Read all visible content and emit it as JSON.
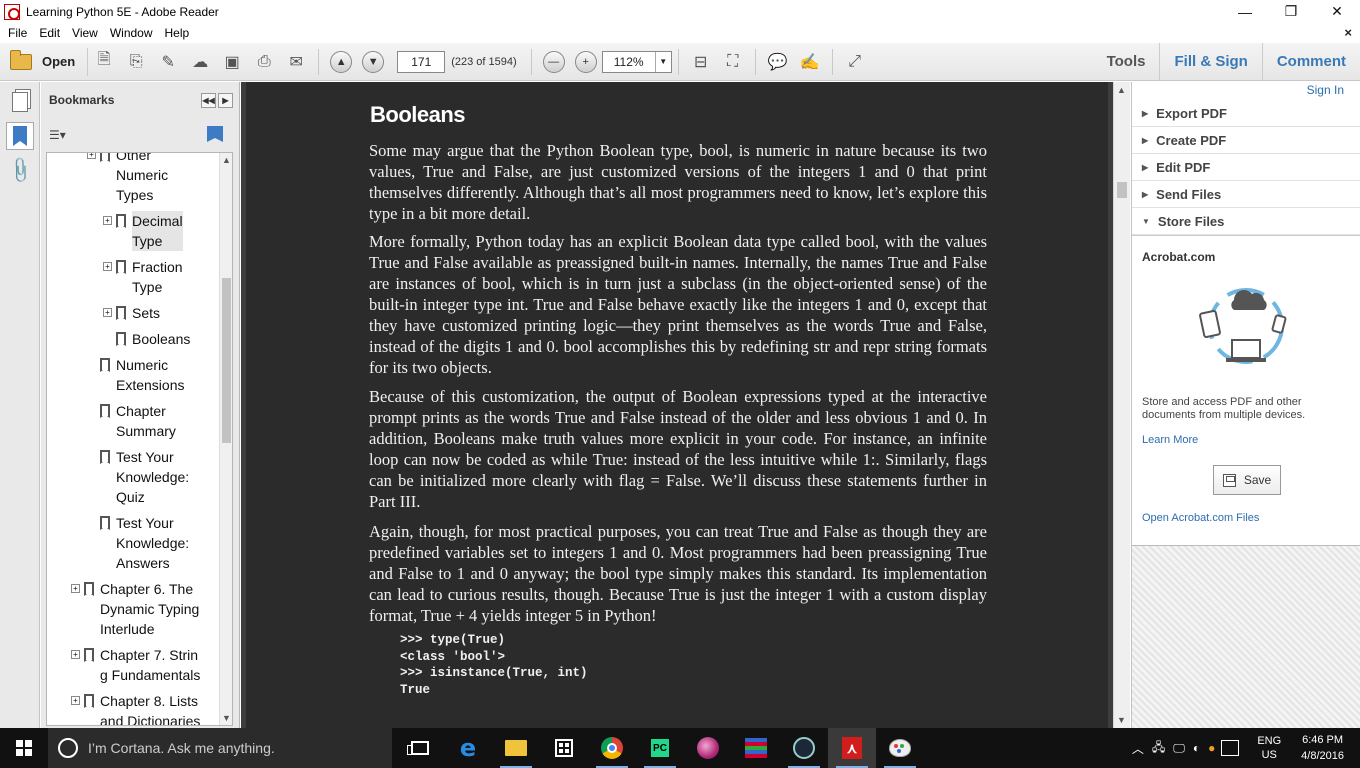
{
  "window": {
    "title": "Learning Python 5E - Adobe Reader",
    "controls": {
      "minimize": "—",
      "maximize": "❐",
      "close": "✕"
    }
  },
  "menu": {
    "items": [
      "File",
      "Edit",
      "View",
      "Window",
      "Help"
    ],
    "close_doc": "×"
  },
  "toolbar": {
    "open_label": "Open",
    "page_number": "171",
    "page_count": "(223 of 1594)",
    "zoom": "112%",
    "tools_label": "Tools",
    "fill_sign_label": "Fill & Sign",
    "comment_label": "Comment",
    "icons": [
      "create-pdf-icon",
      "convert-icon",
      "edit-icon",
      "upload-icon",
      "save-icon",
      "print-icon",
      "email-icon",
      "prev-page-icon",
      "next-page-icon",
      "zoom-out-icon",
      "zoom-in-icon",
      "fit-page-icon",
      "full-screen-icon",
      "comment-icon",
      "highlight-icon",
      "read-mode-icon"
    ]
  },
  "bookmarks": {
    "title": "Bookmarks",
    "options_icon": "options-menu-icon",
    "items": [
      {
        "label": "Other Numeric Types",
        "lines": [
          "Other",
          "Numeric",
          "Types"
        ],
        "level": 2,
        "expander": true,
        "selected": false
      },
      {
        "label": "Decimal Type",
        "lines": [
          "Decimal",
          "Type"
        ],
        "level": 3,
        "expander": true,
        "selected": true
      },
      {
        "label": "Fraction Type",
        "lines": [
          "Fraction",
          "Type"
        ],
        "level": 3,
        "expander": true,
        "selected": false
      },
      {
        "label": "Sets",
        "lines": [
          "Sets"
        ],
        "level": 3,
        "expander": true,
        "selected": false
      },
      {
        "label": "Booleans",
        "lines": [
          "Booleans"
        ],
        "level": 3,
        "expander": false,
        "selected": false
      },
      {
        "label": "Numeric Extensions",
        "lines": [
          "Numeric",
          "Extensions"
        ],
        "level": 2,
        "expander": false,
        "selected": false
      },
      {
        "label": "Chapter Summary",
        "lines": [
          "Chapter",
          "Summary"
        ],
        "level": 2,
        "expander": false,
        "selected": false
      },
      {
        "label": "Test Your Knowledge: Quiz",
        "lines": [
          "Test Your",
          "Knowledge:",
          "Quiz"
        ],
        "level": 2,
        "expander": false,
        "selected": false
      },
      {
        "label": "Test Your Knowledge: Answers",
        "lines": [
          "Test Your",
          "Knowledge:",
          "Answers"
        ],
        "level": 2,
        "expander": false,
        "selected": false
      },
      {
        "label": "Chapter 6. The Dynamic Typing Interlude",
        "lines": [
          "Chapter 6. The",
          "Dynamic Typing",
          "Interlude"
        ],
        "level": 1,
        "expander": true,
        "selected": false
      },
      {
        "label": "Chapter 7. String Fundamentals",
        "lines": [
          "Chapter 7. Strin",
          "g Fundamentals"
        ],
        "level": 1,
        "expander": true,
        "selected": false
      },
      {
        "label": "Chapter 8. Lists and Dictionaries",
        "lines": [
          "Chapter 8. Lists",
          "and Dictionaries"
        ],
        "level": 1,
        "expander": true,
        "selected": false
      }
    ]
  },
  "document": {
    "heading": "Booleans",
    "paragraphs": [
      "Some may argue that the Python Boolean type, bool, is numeric in nature because its two values, True and False, are just customized versions of the integers 1 and 0 that print themselves differently. Although that’s all most programmers need to know, let’s explore this type in a bit more detail.",
      "More formally, Python today has an explicit Boolean data type called bool, with the values True and False available as preassigned built-in names. Internally, the names True and False are instances of bool, which is in turn just a subclass (in the object-oriented sense) of the built-in integer type int. True and False behave exactly like the integers 1 and 0, except that they have customized printing logic—they print themselves as the words True and False, instead of the digits 1 and 0. bool accomplishes this by redefining str and repr string formats for its two objects.",
      "Because of this customization, the output of Boolean expressions typed at the interactive prompt prints as the words True and False instead of the older and less obvious 1 and 0. In addition, Booleans make truth values more explicit in your code. For instance, an infinite loop can now be coded as while True: instead of the less intuitive while 1:. Similarly, flags can be initialized more clearly with flag = False. We’ll discuss these statements further in Part III.",
      "Again, though, for most practical purposes, you can treat True and False as though they are predefined variables set to integers 1 and 0. Most programmers had been preassigning True and False to 1 and 0 anyway; the bool type simply makes this standard. Its implementation can lead to curious results, though. Because True is just the integer 1 with a custom display format, True + 4 yields integer 5 in Python!"
    ],
    "code": ">>> type(True)\n<class 'bool'>\n>>> isinstance(True, int)\nTrue"
  },
  "right_panel": {
    "sign_in": "Sign In",
    "sections": [
      "Export PDF",
      "Create PDF",
      "Edit PDF",
      "Send Files",
      "Store Files"
    ],
    "expanded_section": "Store Files",
    "acrobat_title": "Acrobat.com",
    "description": "Store and access PDF and other documents from multiple devices.",
    "learn_more": "Learn More",
    "save_label": "Save",
    "open_files": "Open Acrobat.com Files"
  },
  "taskbar": {
    "search_placeholder": "I’m Cortana. Ask me anything.",
    "apps": [
      "task-view-icon",
      "edge-icon",
      "file-explorer-icon",
      "store-icon",
      "chrome-icon",
      "pycharm-icon",
      "swirl-app-icon",
      "winrar-icon",
      "steam-icon",
      "adobe-reader-icon",
      "paint-icon"
    ],
    "active_app": "adobe-reader-icon",
    "tray": {
      "lang_top": "ENG",
      "lang_bottom": "US",
      "time": "6:46 PM",
      "date": "4/8/2016"
    }
  }
}
